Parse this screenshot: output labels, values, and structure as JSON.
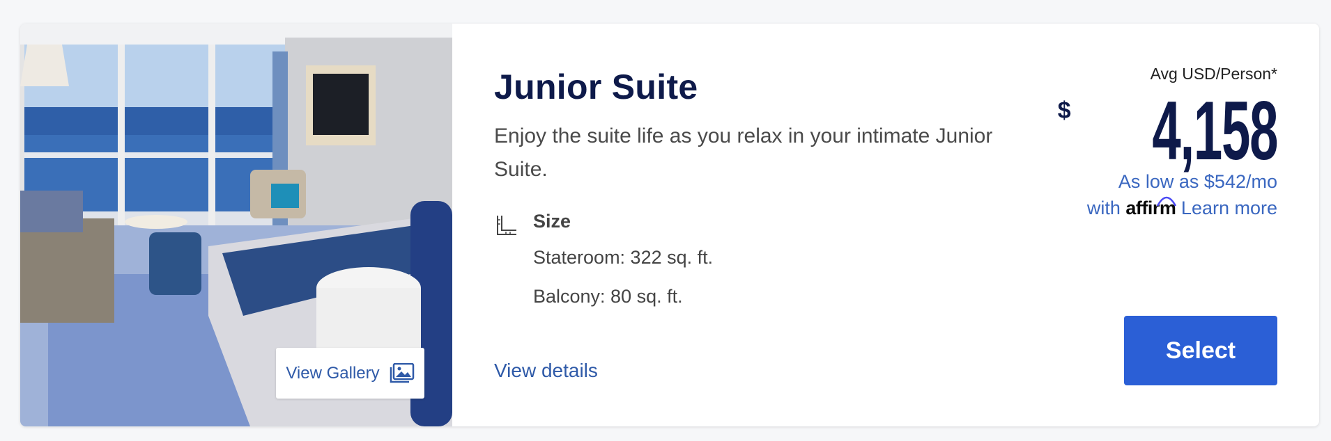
{
  "suite": {
    "title": "Junior Suite",
    "description": "Enjoy the suite life as you relax in your intimate Junior Suite.",
    "size": {
      "icon": "ruler-corner-icon",
      "heading": "Size",
      "stateroom": "Stateroom: 322 sq. ft.",
      "balcony": "Balcony: 80 sq. ft."
    },
    "view_details_label": "View details"
  },
  "gallery": {
    "button_label": "View Gallery",
    "icon": "image-gallery-icon"
  },
  "pricing": {
    "avg_label": "Avg USD/Person*",
    "currency_symbol": "$",
    "amount": "4,158",
    "affirm_prefix": "As low as $542/mo",
    "affirm_with": "with",
    "affirm_logo": "affirm",
    "learn_more": "Learn more"
  },
  "select_label": "Select",
  "colors": {
    "title": "#0e1a4a",
    "link": "#2f5aa8",
    "button": "#2b5fd6"
  }
}
